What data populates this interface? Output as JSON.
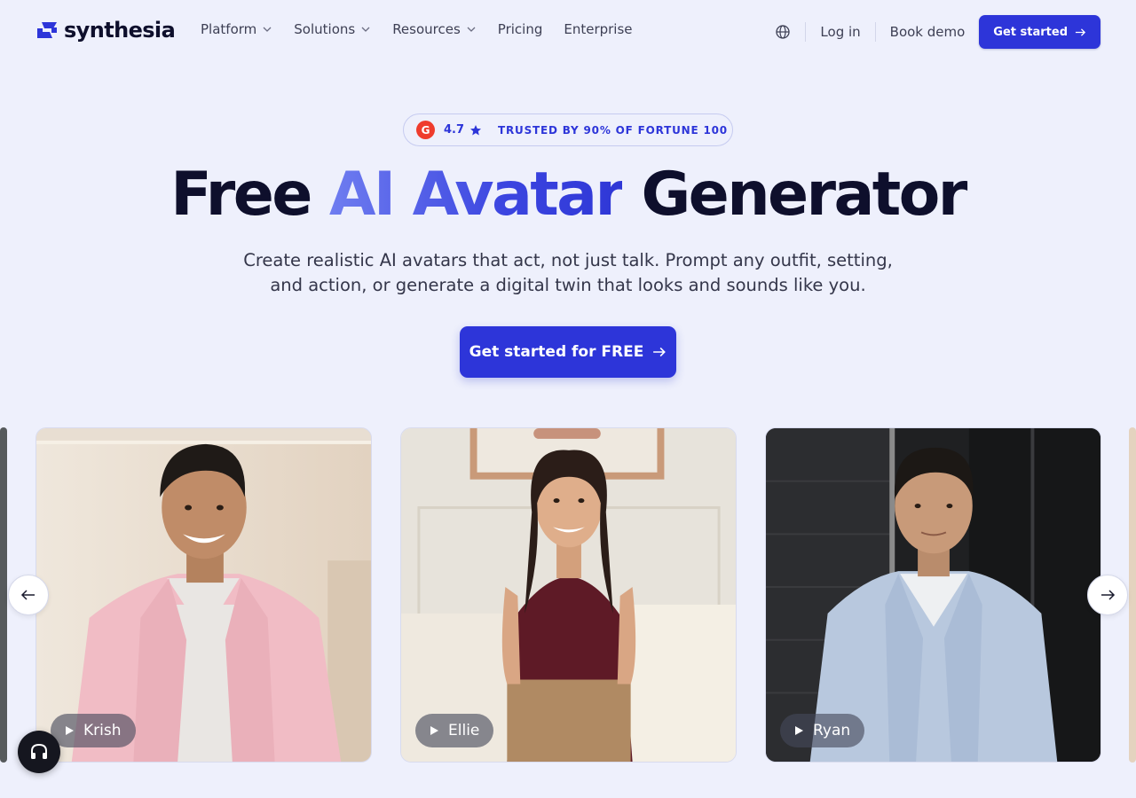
{
  "brand": {
    "name": "synthesia",
    "color": "#2d35d9"
  },
  "nav": {
    "links": [
      {
        "label": "Platform",
        "has_dropdown": true
      },
      {
        "label": "Solutions",
        "has_dropdown": true
      },
      {
        "label": "Resources",
        "has_dropdown": true
      },
      {
        "label": "Pricing",
        "has_dropdown": false
      },
      {
        "label": "Enterprise",
        "has_dropdown": false
      }
    ],
    "language_icon": "globe-icon",
    "login": "Log in",
    "book_demo": "Book demo",
    "get_started": "Get started"
  },
  "badge": {
    "logo_text": "G",
    "rating": "4.7",
    "rating_icon": "star-icon",
    "trusted": "TRUSTED BY 90% OF FORTUNE 100"
  },
  "hero": {
    "title_before": "Free ",
    "title_accent": "AI Avatar",
    "title_after": " Generator",
    "subtitle": "Create realistic AI avatars that act, not just talk. Prompt any outfit, setting, and action, or generate a digital twin that looks and sounds like you.",
    "cta": "Get started for FREE"
  },
  "carousel": {
    "prev_icon": "arrow-left-icon",
    "next_icon": "arrow-right-icon",
    "avatars": [
      {
        "name": "Krish"
      },
      {
        "name": "Ellie"
      },
      {
        "name": "Ryan"
      }
    ]
  },
  "support_icon": "headset-icon"
}
